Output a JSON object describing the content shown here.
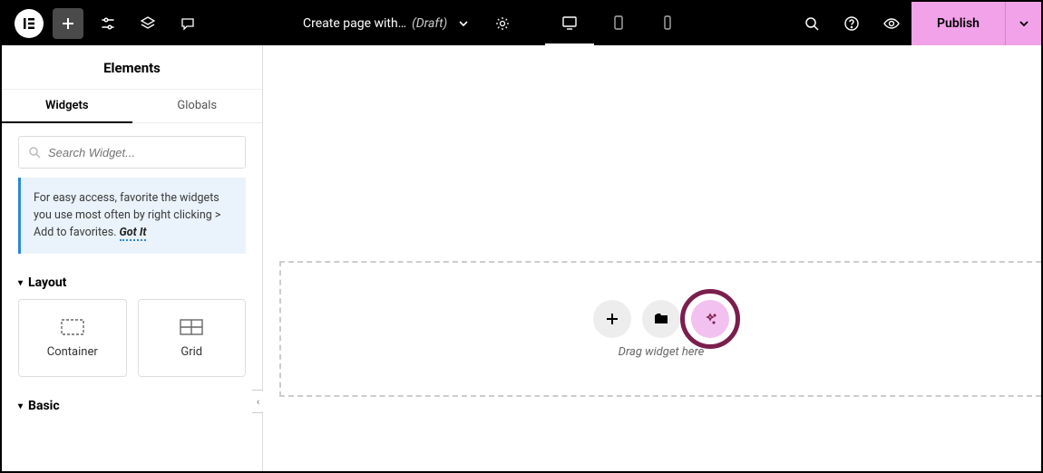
{
  "header": {
    "title": "Create page with…",
    "status": "(Draft)",
    "publish_label": "Publish"
  },
  "sidebar": {
    "heading": "Elements",
    "tabs": {
      "widgets": "Widgets",
      "globals": "Globals"
    },
    "search_placeholder": "Search Widget...",
    "notice_text": "For easy access, favorite the widgets you use most often by right clicking > Add to favorites.",
    "notice_gotit": "Got It",
    "sections": {
      "layout": "Layout",
      "basic": "Basic"
    },
    "widgets": {
      "container": "Container",
      "grid": "Grid"
    }
  },
  "canvas": {
    "drop_label": "Drag widget here"
  }
}
